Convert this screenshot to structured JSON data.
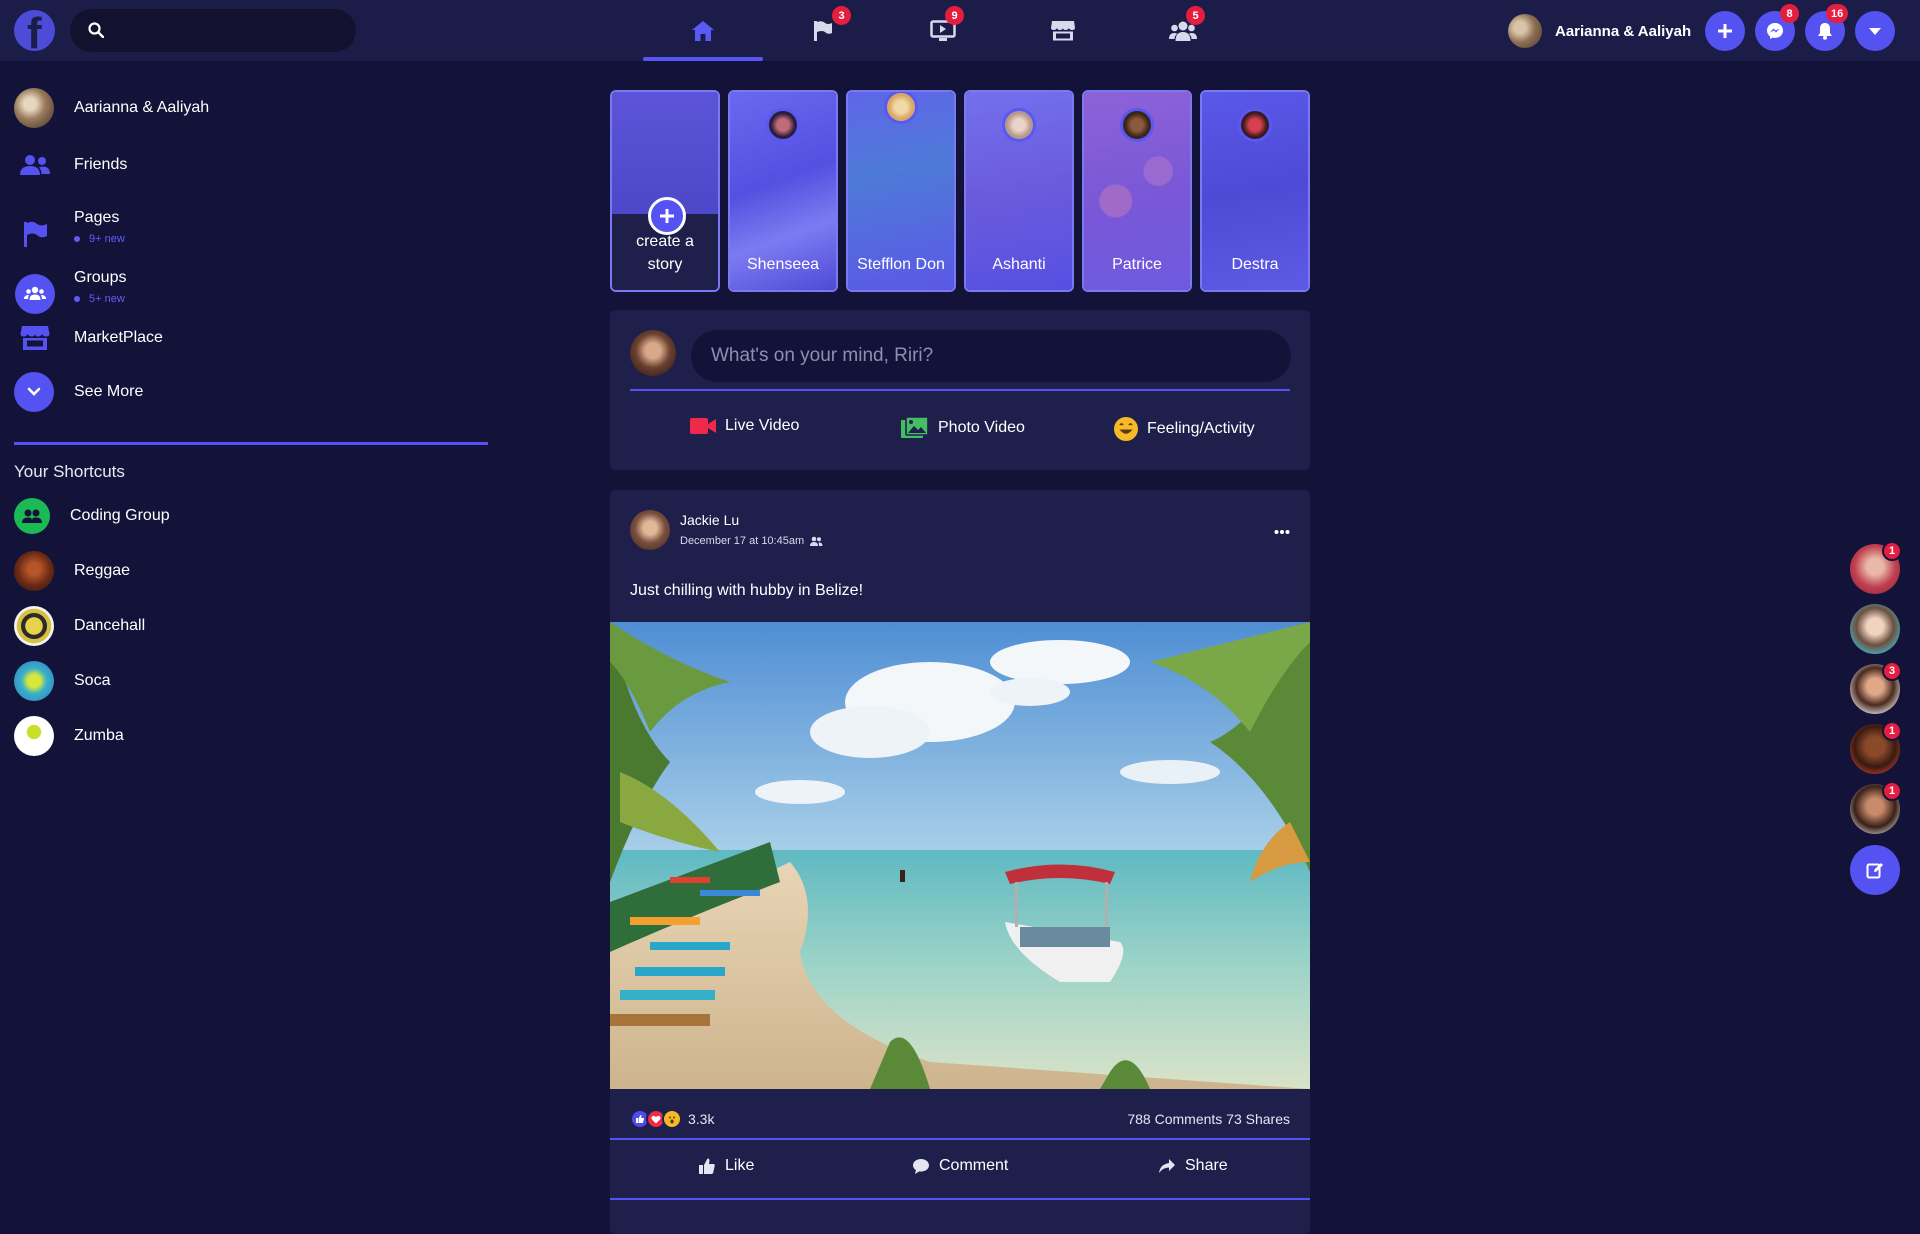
{
  "colors": {
    "accent": "#5452f0",
    "background": "#13133a",
    "card": "#1f1f4c",
    "badge": "#e41e3f",
    "live": "#f02849",
    "photo": "#45bd62",
    "feeling": "#f7b928"
  },
  "header": {
    "logo_icon": "facebook-logo-icon",
    "search_placeholder": "",
    "nav": [
      {
        "icon": "home-icon",
        "badge": ""
      },
      {
        "icon": "flag-icon",
        "badge": "3"
      },
      {
        "icon": "tv-icon",
        "badge": "9"
      },
      {
        "icon": "store-icon",
        "badge": ""
      },
      {
        "icon": "users-icon",
        "badge": "5"
      }
    ],
    "profile_name": "Aarianna & Aaliyah",
    "messenger_badge": "8",
    "notifications_badge": "16"
  },
  "sidebar": {
    "items": [
      {
        "label": "Aarianna & Aaliyah"
      },
      {
        "label": "Friends"
      },
      {
        "label": "Pages",
        "sub": "9+ new"
      },
      {
        "label": "Groups",
        "sub": "5+ new"
      },
      {
        "label": "MarketPlace"
      },
      {
        "label": "See More"
      }
    ],
    "shortcuts_title": "Your Shortcuts",
    "shortcuts": [
      {
        "label": "Coding Group"
      },
      {
        "label": "Reggae"
      },
      {
        "label": "Dancehall"
      },
      {
        "label": "Soca"
      },
      {
        "label": "Zumba"
      }
    ]
  },
  "stories": [
    {
      "label": "create a story"
    },
    {
      "label": "Shenseea"
    },
    {
      "label": "Stefflon Don"
    },
    {
      "label": "Ashanti"
    },
    {
      "label": "Patrice"
    },
    {
      "label": "Destra"
    }
  ],
  "composer": {
    "placeholder": "What's on your mind, Riri?",
    "actions": [
      {
        "label": "Live Video",
        "icon": "video-camera-icon"
      },
      {
        "label": "Photo Video",
        "icon": "photo-icon"
      },
      {
        "label": "Feeling/Activity",
        "icon": "smile-icon"
      }
    ]
  },
  "post": {
    "author": "Jackie Lu",
    "date": "December 17 at 10:45am",
    "text": "Just chilling with hubby in Belize!",
    "reactions_count": "3.3k",
    "comments_shares": "788 Comments 73 Shares",
    "actions": {
      "like": "Like",
      "comment": "Comment",
      "share": "Share"
    }
  },
  "contacts": [
    {
      "badge": "1"
    },
    {
      "badge": ""
    },
    {
      "badge": "3"
    },
    {
      "badge": "1"
    },
    {
      "badge": "1"
    }
  ]
}
